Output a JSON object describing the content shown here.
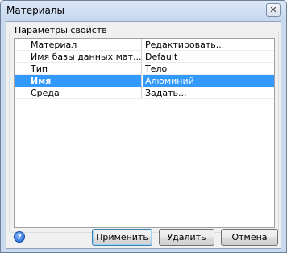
{
  "window": {
    "title": "Материалы"
  },
  "group": {
    "title": "Параметры свойств"
  },
  "properties": [
    {
      "name": "Материал",
      "value": "Редактировать...",
      "selected": false
    },
    {
      "name": "Имя базы данных мат...",
      "value": "Default",
      "selected": false
    },
    {
      "name": "Тип",
      "value": "Тело",
      "selected": false
    },
    {
      "name": "Имя",
      "value": "Алюминий",
      "selected": true
    },
    {
      "name": "Среда",
      "value": "Задать...",
      "selected": false
    }
  ],
  "buttons": {
    "apply": "Применить",
    "delete": "Удалить",
    "cancel": "Отмена"
  },
  "icons": {
    "close": "close-icon",
    "help": "help-icon"
  },
  "colors": {
    "selection": "#3399ff",
    "titlebar": "#c9d9ee"
  }
}
